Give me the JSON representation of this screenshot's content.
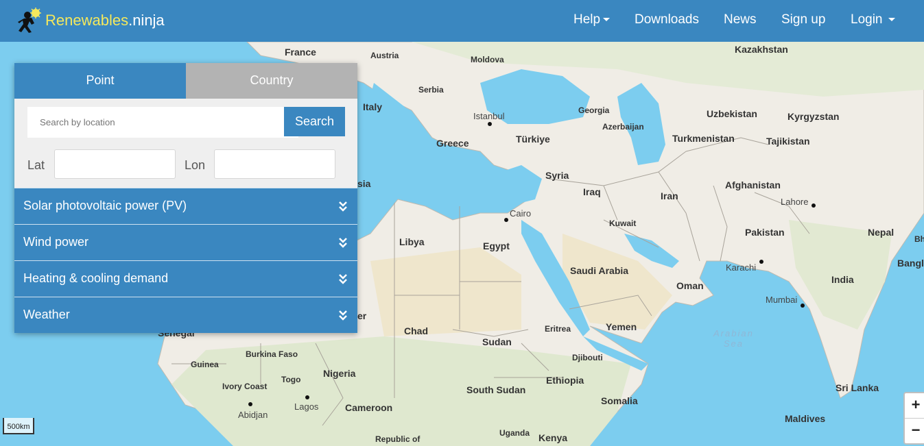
{
  "nav": {
    "brand_name": "Renewables",
    "brand_tld": ".ninja",
    "items": [
      {
        "label": "Help",
        "dropdown": true
      },
      {
        "label": "Downloads",
        "dropdown": false
      },
      {
        "label": "News",
        "dropdown": false
      },
      {
        "label": "Sign up",
        "dropdown": false
      },
      {
        "label": "Login",
        "dropdown": true
      }
    ]
  },
  "panel": {
    "tabs": [
      {
        "label": "Point",
        "active": true
      },
      {
        "label": "Country",
        "active": false
      }
    ],
    "search_placeholder": "Search by location",
    "search_button": "Search",
    "lat_label": "Lat",
    "lon_label": "Lon",
    "lat_value": "",
    "lon_value": "",
    "sections": [
      "Solar photovoltaic power (PV)",
      "Wind power",
      "Heating & cooling demand",
      "Weather"
    ]
  },
  "map": {
    "scale": "500km",
    "zoom_in": "+",
    "zoom_out": "−",
    "countries": {
      "france": "France",
      "austria": "Austria",
      "moldova": "Moldova",
      "kazakhstan": "Kazakhstan",
      "serbia": "Serbia",
      "italy": "Italy",
      "georgia": "Georgia",
      "uzbekistan": "Uzbekistan",
      "kyrgyzstan": "Kyrgyzstan",
      "azerbaijan": "Azerbaijan",
      "greece": "Greece",
      "turkiye": "Türkiye",
      "turkmenistan": "Turkmenistan",
      "tajikistan": "Tajikistan",
      "syria": "Syria",
      "iraq": "Iraq",
      "afghanistan": "Afghanistan",
      "iran": "Iran",
      "kuwait": "Kuwait",
      "libya": "Libya",
      "egypt": "Egypt",
      "pakistan": "Pakistan",
      "nepal": "Nepal",
      "saudi": "Saudi Arabia",
      "oman": "Oman",
      "india": "India",
      "bangladesh": "Bangl",
      "bhutan": "Bh",
      "chad": "Chad",
      "sudan": "Sudan",
      "eritrea": "Eritrea",
      "yemen": "Yemen",
      "senegal": "Senegal",
      "burkina": "Burkina Faso",
      "djibouti": "Djibouti",
      "guinea": "Guinea",
      "nigeria": "Nigeria",
      "ethiopia": "Ethiopia",
      "togo": "Togo",
      "ivory": "Ivory Coast",
      "southsudan": "South Sudan",
      "somalia": "Somalia",
      "srilanka": "Sri Lanka",
      "cameroon": "Cameroon",
      "maldives": "Maldives",
      "uganda": "Uganda",
      "kenya": "Kenya",
      "car": "Republic of",
      "tunisia": "sia",
      "niger": "er"
    },
    "cities": {
      "istanbul": "Istanbul",
      "cairo": "Cairo",
      "lahore": "Lahore",
      "karachi": "Karachi",
      "mumbai": "Mumbai",
      "abidjan": "Abidjan",
      "lagos": "Lagos"
    },
    "seas": {
      "arabian_1": "Arabian",
      "arabian_2": "Sea"
    }
  }
}
